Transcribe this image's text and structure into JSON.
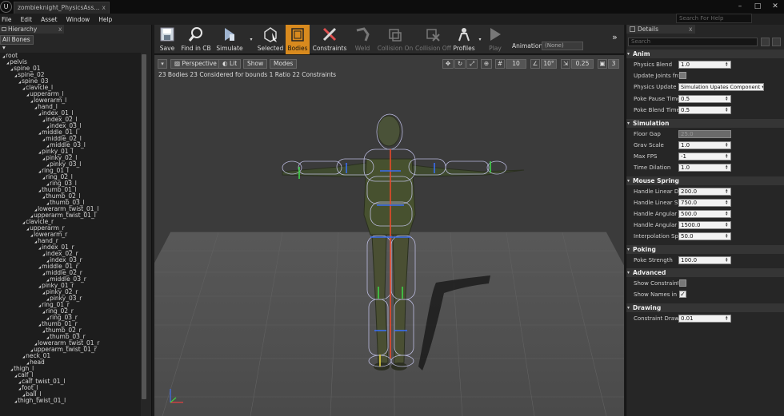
{
  "window": {
    "tab_title": "zombieknight_PhysicsAss...",
    "tab_close": "x",
    "app_icon": "U",
    "minimize": "–",
    "maximize": "□",
    "close": "✕"
  },
  "menu": {
    "items": [
      "File",
      "Edit",
      "Asset",
      "Window",
      "Help"
    ],
    "search_placeholder": "Search For Help"
  },
  "hierarchy": {
    "tab_label": "Hierarchy",
    "close": "x",
    "filter_label": "All Bones",
    "bones": [
      {
        "name": "root",
        "depth": 0
      },
      {
        "name": "pelvis",
        "depth": 1
      },
      {
        "name": "spine_01",
        "depth": 2
      },
      {
        "name": "spine_02",
        "depth": 3
      },
      {
        "name": "spine_03",
        "depth": 4
      },
      {
        "name": "clavicle_l",
        "depth": 5
      },
      {
        "name": "upperarm_l",
        "depth": 6
      },
      {
        "name": "lowerarm_l",
        "depth": 7
      },
      {
        "name": "hand_l",
        "depth": 8
      },
      {
        "name": "index_01_l",
        "depth": 9
      },
      {
        "name": "index_02_l",
        "depth": 10
      },
      {
        "name": "index_03_l",
        "depth": 11
      },
      {
        "name": "middle_01_l",
        "depth": 9
      },
      {
        "name": "middle_02_l",
        "depth": 10
      },
      {
        "name": "middle_03_l",
        "depth": 11
      },
      {
        "name": "pinky_01_l",
        "depth": 9
      },
      {
        "name": "pinky_02_l",
        "depth": 10
      },
      {
        "name": "pinky_03_l",
        "depth": 11
      },
      {
        "name": "ring_01_l",
        "depth": 9
      },
      {
        "name": "ring_02_l",
        "depth": 10
      },
      {
        "name": "ring_03_l",
        "depth": 11
      },
      {
        "name": "thumb_01_l",
        "depth": 9
      },
      {
        "name": "thumb_02_l",
        "depth": 10
      },
      {
        "name": "thumb_03_l",
        "depth": 11
      },
      {
        "name": "lowerarm_twist_01_l",
        "depth": 8
      },
      {
        "name": "upperarm_twist_01_l",
        "depth": 7
      },
      {
        "name": "clavicle_r",
        "depth": 5
      },
      {
        "name": "upperarm_r",
        "depth": 6
      },
      {
        "name": "lowerarm_r",
        "depth": 7
      },
      {
        "name": "hand_r",
        "depth": 8
      },
      {
        "name": "index_01_r",
        "depth": 9
      },
      {
        "name": "index_02_r",
        "depth": 10
      },
      {
        "name": "index_03_r",
        "depth": 11
      },
      {
        "name": "middle_01_r",
        "depth": 9
      },
      {
        "name": "middle_02_r",
        "depth": 10
      },
      {
        "name": "middle_03_r",
        "depth": 11
      },
      {
        "name": "pinky_01_r",
        "depth": 9
      },
      {
        "name": "pinky_02_r",
        "depth": 10
      },
      {
        "name": "pinky_03_r",
        "depth": 11
      },
      {
        "name": "ring_01_r",
        "depth": 9
      },
      {
        "name": "ring_02_r",
        "depth": 10
      },
      {
        "name": "ring_03_r",
        "depth": 11
      },
      {
        "name": "thumb_01_r",
        "depth": 9
      },
      {
        "name": "thumb_02_r",
        "depth": 10
      },
      {
        "name": "thumb_03_r",
        "depth": 11
      },
      {
        "name": "lowerarm_twist_01_r",
        "depth": 8
      },
      {
        "name": "upperarm_twist_01_r",
        "depth": 7
      },
      {
        "name": "neck_01",
        "depth": 5
      },
      {
        "name": "head",
        "depth": 6
      },
      {
        "name": "thigh_l",
        "depth": 2
      },
      {
        "name": "calf_l",
        "depth": 3
      },
      {
        "name": "calf_twist_01_l",
        "depth": 4
      },
      {
        "name": "foot_l",
        "depth": 4
      },
      {
        "name": "ball_l",
        "depth": 5
      },
      {
        "name": "thigh_twist_01_l",
        "depth": 3
      }
    ]
  },
  "toolbar": {
    "buttons": [
      {
        "label": "Save",
        "icon": "save-icon",
        "state": "normal"
      },
      {
        "label": "Find in CB",
        "icon": "magnifier-icon",
        "state": "normal"
      },
      {
        "label": "Simulate",
        "icon": "simulate-icon",
        "state": "normal"
      },
      {
        "label": "Selected",
        "icon": "selected-icon",
        "state": "normal"
      },
      {
        "label": "Bodies",
        "icon": "bodies-icon",
        "state": "active"
      },
      {
        "label": "Constraints",
        "icon": "constraints-icon",
        "state": "normal"
      },
      {
        "label": "Weld",
        "icon": "weld-icon",
        "state": "disabled"
      },
      {
        "label": "Collision On",
        "icon": "collision-on-icon",
        "state": "disabled"
      },
      {
        "label": "Collision Off",
        "icon": "collision-off-icon",
        "state": "disabled"
      },
      {
        "label": "Profiles",
        "icon": "profiles-icon",
        "state": "normal"
      },
      {
        "label": "Play",
        "icon": "play-icon",
        "state": "disabled"
      }
    ],
    "animation_label": "Animation:",
    "animation_value": "(None)",
    "more_glyph": "»",
    "accent_color": "#d88a1e"
  },
  "viewport": {
    "menu_glyph": "▾",
    "buttons": [
      "Perspective",
      "Lit",
      "Show",
      "Modes"
    ],
    "stats": "23 Bodies  23 Considered for bounds  1 Ratio  22 Constraints",
    "grid_snap": "10",
    "rot_snap": "10°",
    "scale_snap": "0.25",
    "camera_speed": "3"
  },
  "details": {
    "tab_label": "Details",
    "close": "x",
    "search_placeholder": "Search",
    "categories": [
      {
        "title": "Anim",
        "props": [
          {
            "label": "Physics Blend",
            "type": "number",
            "value": "1.0"
          },
          {
            "label": "Update Joints from",
            "type": "checkbox",
            "checked": false
          },
          {
            "label": "Physics Update M",
            "type": "select",
            "value": "Simulation Upates Component"
          },
          {
            "label": "Poke Pause Time",
            "type": "number",
            "value": "0.5"
          },
          {
            "label": "Poke Blend Time",
            "type": "number",
            "value": "0.5"
          }
        ]
      },
      {
        "title": "Simulation",
        "props": [
          {
            "label": "Floor Gap",
            "type": "number",
            "value": "25.0",
            "disabled": true
          },
          {
            "label": "Grav Scale",
            "type": "number",
            "value": "1.0"
          },
          {
            "label": "Max FPS",
            "type": "number",
            "value": "-1"
          },
          {
            "label": "Time Dilation",
            "type": "number",
            "value": "1.0"
          }
        ]
      },
      {
        "title": "Mouse Spring",
        "props": [
          {
            "label": "Handle Linear Dan",
            "type": "number",
            "value": "200.0"
          },
          {
            "label": "Handle Linear Stif",
            "type": "number",
            "value": "750.0"
          },
          {
            "label": "Handle Angular Da",
            "type": "number",
            "value": "500.0"
          },
          {
            "label": "Handle Angular St",
            "type": "number",
            "value": "1500.0"
          },
          {
            "label": "Interpolation Spee",
            "type": "number",
            "value": "50.0"
          }
        ]
      },
      {
        "title": "Poking",
        "props": [
          {
            "label": "Poke Strength",
            "type": "number",
            "value": "100.0"
          }
        ]
      },
      {
        "title": "Advanced",
        "props": [
          {
            "label": "Show Constraints",
            "type": "checkbox",
            "checked": false
          },
          {
            "label": "Show Names in Hi",
            "type": "checkbox",
            "checked": true
          }
        ]
      },
      {
        "title": "Drawing",
        "props": [
          {
            "label": "Constraint Draw S",
            "type": "number",
            "value": "0.01"
          }
        ]
      }
    ]
  }
}
